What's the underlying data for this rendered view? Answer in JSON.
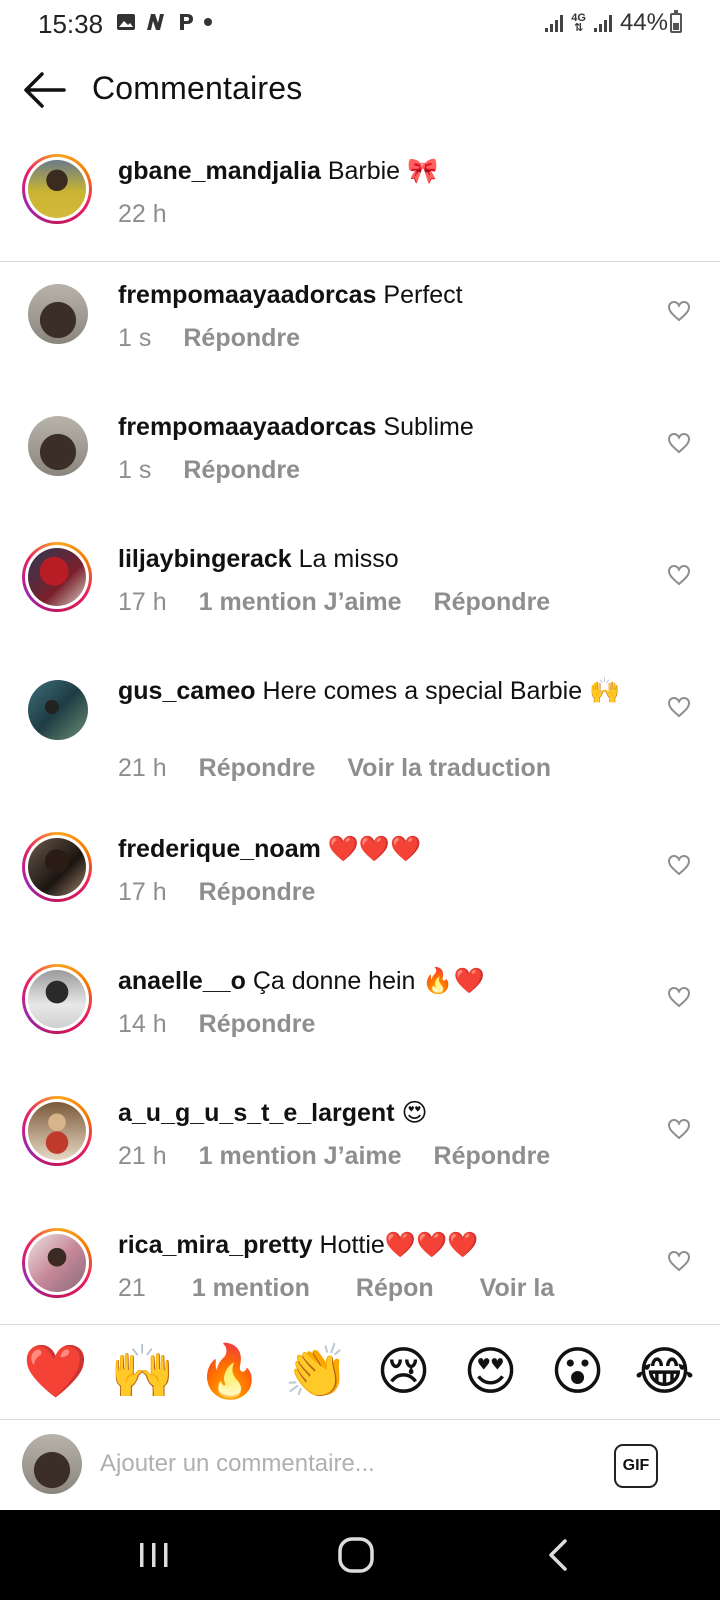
{
  "status_bar": {
    "time": "15:38",
    "left_icons": [
      "image-icon",
      "n-app-icon",
      "p-app-icon",
      "dot-icon"
    ],
    "network_label": "4G",
    "battery_text": "44%",
    "battery_level": 0.44
  },
  "header": {
    "title": "Commentaires"
  },
  "caption": {
    "username": "gbane_mandjalia",
    "text": "Barbie 🎀",
    "time": "22 h"
  },
  "comments": [
    {
      "username": "frempomaayaadorcas",
      "text": "Perfect",
      "time": "1 s",
      "likes": "",
      "reply": "Répondre",
      "translate": ""
    },
    {
      "username": "frempomaayaadorcas",
      "text": "Sublime",
      "time": "1 s",
      "likes": "",
      "reply": "Répondre",
      "translate": ""
    },
    {
      "username": "liljaybingerack",
      "text": "La misso",
      "time": "17 h",
      "likes": "1 mention J’aime",
      "reply": "Répondre",
      "translate": ""
    },
    {
      "username": "gus_cameo",
      "text": "Here comes a special Barbie 🙌",
      "time": "21 h",
      "likes": "",
      "reply": "Répondre",
      "translate": "Voir la traduction"
    },
    {
      "username": "frederique_noam",
      "text": "❤️❤️❤️",
      "time": "17 h",
      "likes": "",
      "reply": "Répondre",
      "translate": ""
    },
    {
      "username": "anaelle__o",
      "text": "Ça donne hein 🔥❤️",
      "time": "14 h",
      "likes": "",
      "reply": "Répondre",
      "translate": ""
    },
    {
      "username": "a_u_g_u_s_t_e_largent",
      "text": "😍",
      "time": "21 h",
      "likes": "1 mention J’aime",
      "reply": "Répondre",
      "translate": ""
    },
    {
      "username": "rica_mira_pretty",
      "text": "Hottie❤️❤️❤️",
      "time": "21",
      "likes": "1 mention",
      "reply": "Répon",
      "translate": "Voir la"
    }
  ],
  "emoji_bar": [
    "❤️",
    "🙌",
    "🔥",
    "👏",
    "😢",
    "😍",
    "😮",
    "😂"
  ],
  "compose": {
    "placeholder": "Ajouter un commentaire...",
    "gif_label": "GIF"
  },
  "colors": {
    "text": "#111111",
    "meta": "#8e8e8e",
    "divider": "#dbdbdb",
    "nav_bar": "#000000"
  }
}
